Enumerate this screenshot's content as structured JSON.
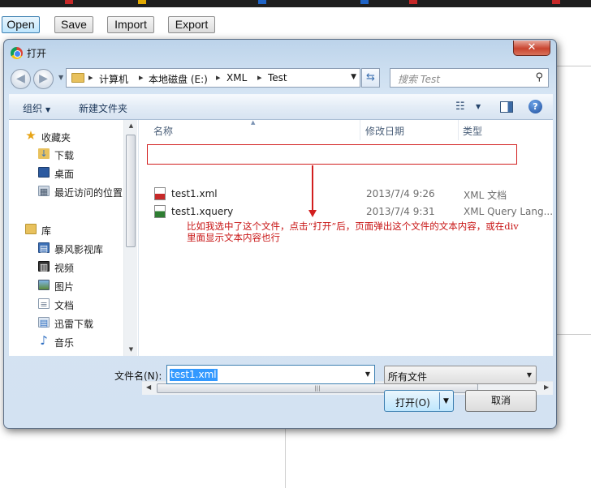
{
  "page": {
    "buttons": {
      "open": "Open",
      "save": "Save",
      "import": "Import",
      "export": "Export"
    }
  },
  "dialog": {
    "title": "打开",
    "close_glyph": "✕",
    "address": {
      "segments": [
        "计算机",
        "本地磁盘 (E:)",
        "XML",
        "Test"
      ],
      "separator": "▸"
    },
    "search_placeholder": "搜索 Test",
    "toolbar": {
      "organize": "组织",
      "new_folder": "新建文件夹"
    },
    "nav": {
      "favorites_header": "收藏夹",
      "favorites": [
        "下载",
        "桌面",
        "最近访问的位置"
      ],
      "library_header": "库",
      "libraries": [
        "暴风影视库",
        "视频",
        "图片",
        "文档",
        "迅雷下载",
        "音乐"
      ]
    },
    "columns": {
      "name": "名称",
      "date": "修改日期",
      "type": "类型"
    },
    "files": [
      {
        "name": "test1.xml",
        "date": "2013/7/4 9:26",
        "type": "XML 文档",
        "icon": "xml-file-icon"
      },
      {
        "name": "test1.xquery",
        "date": "2013/7/4 9:31",
        "type": "XML Query Lang...",
        "icon": "xquery-file-icon"
      }
    ],
    "annotation": "比如我选中了这个文件，点击“打开”后，页面弹出这个文件的文本内容，或在div里面显示文本内容也行",
    "filename_label": "文件名(N):",
    "filename_value": "test1.xml",
    "file_type": "所有文件",
    "open_button": "打开(O)",
    "cancel_button": "取消"
  },
  "colors": {
    "annotation": "#c81414",
    "selection": "#3399ff",
    "dialog_frame": "#c9dcef"
  }
}
